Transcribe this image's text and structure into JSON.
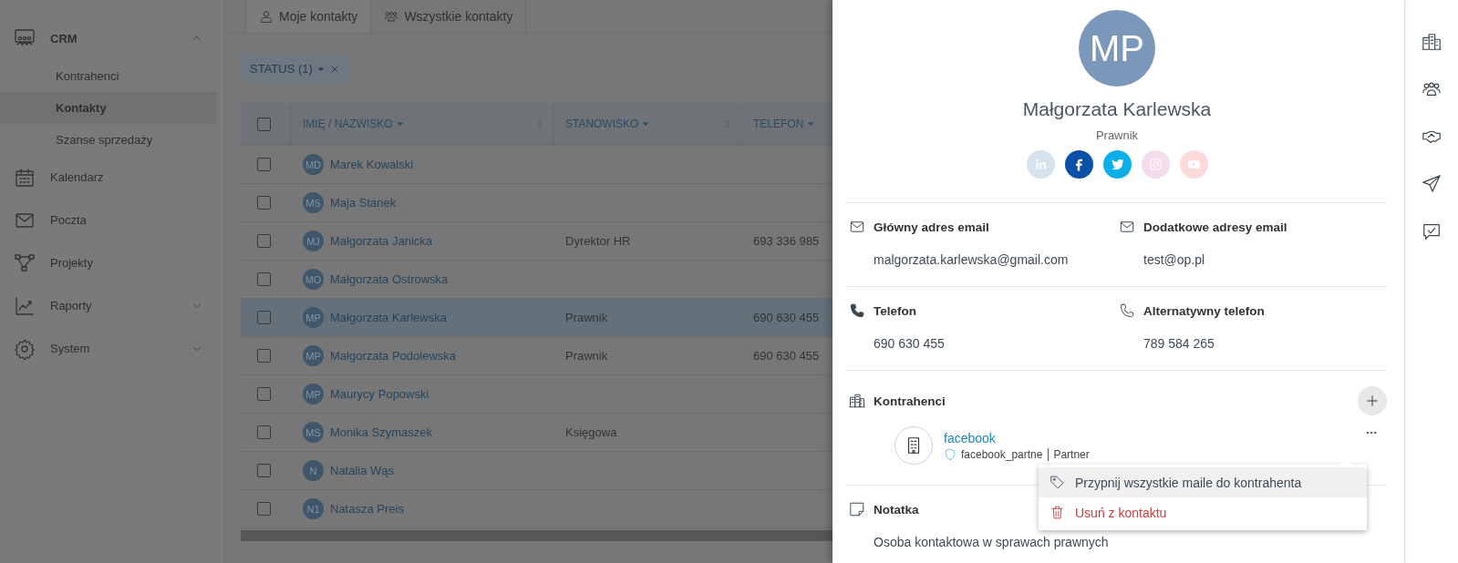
{
  "sidebar": {
    "items": [
      {
        "kind": "crm",
        "label": "CRM",
        "expanded": true,
        "children": [
          {
            "label": "Kontrahenci",
            "selected": false
          },
          {
            "label": "Kontakty",
            "selected": true
          },
          {
            "label": "Szanse sprzedaży",
            "selected": false
          }
        ]
      },
      {
        "kind": "calendar",
        "label": "Kalendarz"
      },
      {
        "kind": "mail",
        "label": "Poczta"
      },
      {
        "kind": "projects",
        "label": "Projekty"
      },
      {
        "kind": "reports",
        "label": "Raporty",
        "expanded": false
      },
      {
        "kind": "gear",
        "label": "System",
        "expanded": false
      }
    ]
  },
  "tabs": [
    {
      "kind": "person",
      "label": "Moje kontakty",
      "selected": true
    },
    {
      "kind": "people",
      "label": "Wszystkie kontakty",
      "selected": false
    }
  ],
  "filter": {
    "label": "STATUS (1)"
  },
  "table": {
    "all_checked": false,
    "columns": [
      {
        "label": "IMIĘ / NAZWISKO"
      },
      {
        "label": "STANOWISKO"
      },
      {
        "label": "TELEFON"
      }
    ],
    "rows": [
      {
        "initials": "MD",
        "name": "Marek Kowalski",
        "checked": false,
        "selected": false
      },
      {
        "initials": "MS",
        "name": "Maja Stanek",
        "checked": false,
        "selected": false
      },
      {
        "initials": "MJ",
        "name": "Małgorzata Janicka",
        "position": "Dyrektor HR",
        "phone": "693 336 985",
        "checked": false,
        "selected": false
      },
      {
        "initials": "MO",
        "name": "Małgorzata Ostrowska",
        "checked": false,
        "selected": false
      },
      {
        "initials": "MP",
        "name": "Małgorzata Karlewska",
        "position": "Prawnik",
        "phone": "690 630 455",
        "checked": false,
        "selected": true
      },
      {
        "initials": "MP",
        "name": "Małgorzata Podolewska",
        "position": "Prawnik",
        "phone": "690 630 455",
        "checked": false,
        "selected": false
      },
      {
        "initials": "MP",
        "name": "Maurycy Popowski",
        "checked": false,
        "selected": false
      },
      {
        "initials": "MS",
        "name": "Monika Szymaszek",
        "position": "Księgowa",
        "checked": false,
        "selected": false
      },
      {
        "initials": "N",
        "name": "Natalia Wąs",
        "checked": false,
        "selected": false
      },
      {
        "initials": "N1",
        "name": "Natasza Preis",
        "checked": false,
        "selected": false
      }
    ]
  },
  "contact": {
    "initials": "MP",
    "name": "Małgorzata Karlewska",
    "position": "Prawnik",
    "socials": [
      {
        "kind": "linkedin",
        "color": "#d5e3ef"
      },
      {
        "kind": "facebook",
        "color": "#0a4fa8"
      },
      {
        "kind": "twitter",
        "color": "#0bb0e8"
      },
      {
        "kind": "instagram",
        "color": "#f4dced"
      },
      {
        "kind": "youtube",
        "color": "#fcdadb"
      }
    ],
    "field_rows": [
      [
        {
          "kind": "email",
          "label": "Główny adres email",
          "value": "malgorzata.karlewska@gmail.com"
        },
        {
          "kind": "email",
          "label": "Dodatkowe adresy email",
          "value": "test@op.pl"
        }
      ],
      [
        {
          "kind": "phone",
          "label": "Telefon",
          "value": "690 630 455"
        },
        {
          "kind": "phone-alt",
          "label": "Alternatywny telefon",
          "value": "789 584 265"
        }
      ]
    ],
    "contractors": {
      "title": "Kontrahenci",
      "items": [
        {
          "name": "facebook",
          "tag": "facebook_partne",
          "role": "Partner",
          "menu": [
            {
              "kind": "pin",
              "label": "Przypnij wszystkie maile do kontrahenta",
              "highlighted": true
            },
            {
              "kind": "remove",
              "label": "Usuń z kontaktu",
              "highlighted": false
            }
          ]
        }
      ]
    },
    "note": {
      "title": "Notatka",
      "text": "Osoba kontaktowa w sprawach prawnych"
    }
  },
  "right_rail": [
    {
      "kind": "buildings"
    },
    {
      "kind": "people"
    },
    {
      "kind": "handshake"
    },
    {
      "kind": "send"
    },
    {
      "kind": "chat"
    }
  ]
}
